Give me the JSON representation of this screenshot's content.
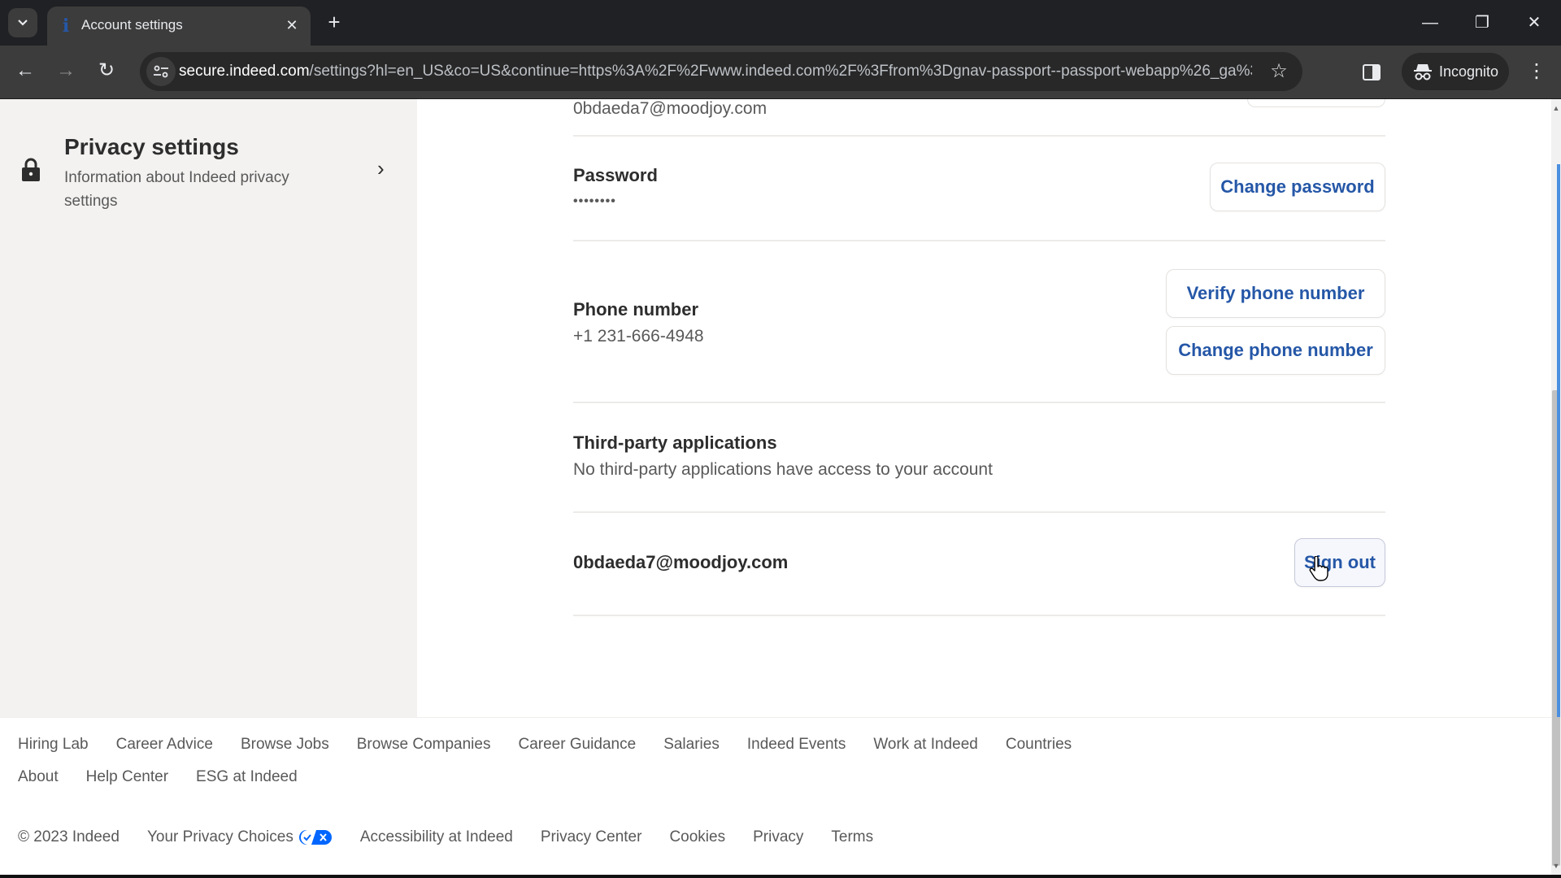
{
  "browser": {
    "tab_title": "Account settings",
    "url_host": "secure.indeed.com",
    "url_rest": "/settings?hl=en_US&co=US&continue=https%3A%2F%2Fwww.indeed.com%2F%3Ffrom%3Dgnav-passport--passport-webapp%26_ga%3...",
    "incognito_label": "Incognito",
    "icons": {
      "tab_search": "chevron-down-icon",
      "favicon": "indeed-favicon",
      "tab_close": "close-icon",
      "new_tab": "plus-icon",
      "back": "arrow-left-icon",
      "forward": "arrow-right-icon",
      "reload": "reload-icon",
      "site_info": "tune-icon",
      "bookmark": "star-icon",
      "side_panel": "side-panel-icon",
      "incognito": "incognito-icon",
      "menu": "more-vertical-icon",
      "minimize": "minimize-icon",
      "maximize": "restore-icon",
      "close": "close-icon"
    },
    "glyphs": {
      "tab_close": "✕",
      "new_tab": "+",
      "back": "←",
      "forward": "→",
      "reload": "↻",
      "star": "☆",
      "menu": "⋮",
      "minimize": "—",
      "restore": "❐",
      "close": "✕",
      "chevron_right": "›"
    }
  },
  "sidebar": {
    "privacy_settings": {
      "title": "Privacy settings",
      "description": "Information about Indeed privacy settings"
    }
  },
  "main": {
    "cut_off_email": "0bdaeda7@moodjoy.com",
    "password": {
      "label": "Password",
      "value": "••••••••",
      "button": "Change password"
    },
    "phone": {
      "label": "Phone number",
      "value": "+1 231-666-4948",
      "verify_button": "Verify phone number",
      "change_button": "Change phone number"
    },
    "third_party": {
      "label": "Third-party applications",
      "description": "No third-party applications have access to your account"
    },
    "account": {
      "email": "0bdaeda7@moodjoy.com",
      "sign_out_button": "Sign out"
    }
  },
  "footer": {
    "row1": [
      "Hiring Lab",
      "Career Advice",
      "Browse Jobs",
      "Browse Companies",
      "Career Guidance",
      "Salaries",
      "Indeed Events",
      "Work at Indeed",
      "Countries"
    ],
    "row2": [
      "About",
      "Help Center",
      "ESG at Indeed"
    ],
    "copyright": "© 2023 Indeed",
    "legal": [
      "Your Privacy Choices",
      "Accessibility at Indeed",
      "Privacy Center",
      "Cookies",
      "Privacy",
      "Terms"
    ]
  },
  "colors": {
    "brand_blue": "#2557a7",
    "sidebar_bg": "#f3f2f1",
    "text_primary": "#2d2d2d",
    "text_secondary": "#595959",
    "privacy_choices_blue": "#0066ff"
  }
}
